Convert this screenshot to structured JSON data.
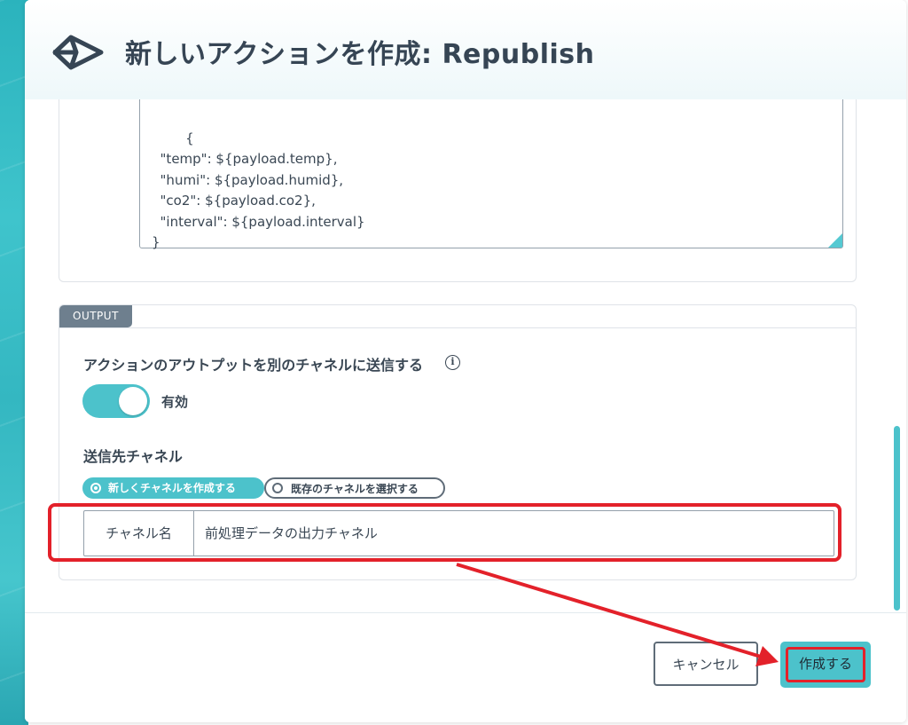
{
  "dialog": {
    "title": "新しいアクションを作成: Republish"
  },
  "payload_template": "{\n  \"temp\": ${payload.temp},\n  \"humi\": ${payload.humid},\n  \"co2\": ${payload.co2},\n  \"interval\": ${payload.interval}\n}",
  "output": {
    "section_tag": "OUTPUT",
    "send_label": "アクションのアウトプットを別のチャネルに送信する",
    "info_icon": "i",
    "toggle": {
      "label": "有効",
      "state": "on"
    },
    "destination_label": "送信先チャネル",
    "radio_options": [
      {
        "label": "新しくチャネルを作成する",
        "selected": true
      },
      {
        "label": "既存のチャネルを選択する",
        "selected": false
      }
    ],
    "channel_field": {
      "label": "チャネル名",
      "value": "前処理データの出力チャネル"
    }
  },
  "footer": {
    "cancel_label": "キャンセル",
    "create_label": "作成する"
  },
  "colors": {
    "accent": "#4cc2cb",
    "annotation": "#e3212a",
    "text": "#3a4754",
    "tag": "#6e7f8e"
  }
}
